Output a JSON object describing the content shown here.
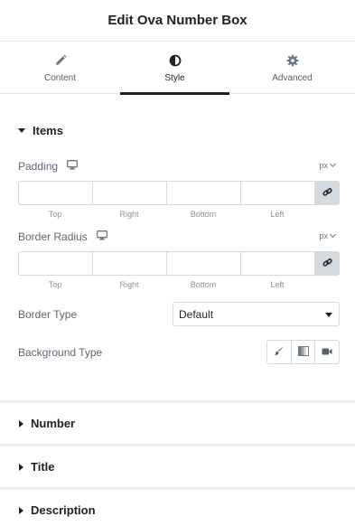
{
  "header": {
    "title": "Edit Ova Number Box"
  },
  "tabs": [
    {
      "label": "Content",
      "icon": "pencil-icon"
    },
    {
      "label": "Style",
      "icon": "half-circle-icon"
    },
    {
      "label": "Advanced",
      "icon": "gear-icon"
    }
  ],
  "active_tab": "Style",
  "sections": {
    "items": {
      "label": "Items",
      "padding": {
        "label": "Padding",
        "unit": "px",
        "values": {
          "top": "",
          "right": "",
          "bottom": "",
          "left": ""
        },
        "side_labels": [
          "Top",
          "Right",
          "Bottom",
          "Left"
        ]
      },
      "border_radius": {
        "label": "Border Radius",
        "unit": "px",
        "values": {
          "top": "",
          "right": "",
          "bottom": "",
          "left": ""
        },
        "side_labels": [
          "Top",
          "Right",
          "Bottom",
          "Left"
        ]
      },
      "border_type": {
        "label": "Border Type",
        "value": "Default"
      },
      "background_type": {
        "label": "Background Type",
        "options": [
          "brush-icon",
          "gradient-icon",
          "video-icon"
        ]
      }
    },
    "number": {
      "label": "Number"
    },
    "title": {
      "label": "Title"
    },
    "description": {
      "label": "Description"
    }
  },
  "colors": {
    "accent": "#1f2124",
    "border": "#d5dadf",
    "label": "#5c6670",
    "link_bg": "#d5dadf"
  }
}
